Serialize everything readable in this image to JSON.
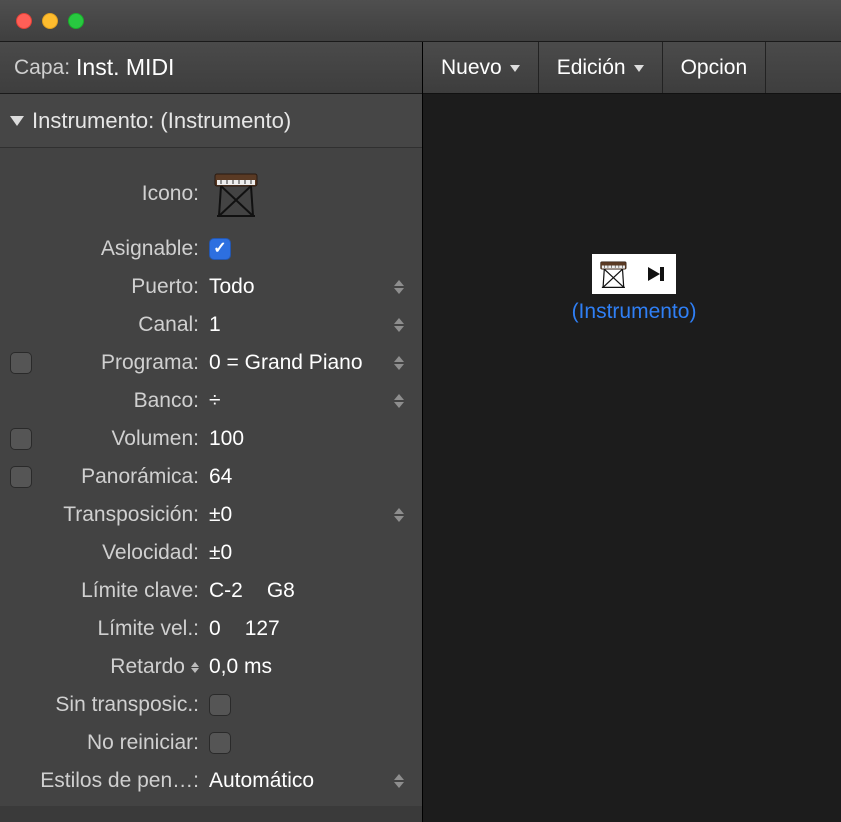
{
  "titlebar": {},
  "toolbar": {
    "buttons": [
      {
        "label": "Nuevo"
      },
      {
        "label": "Edición"
      },
      {
        "label": "Opcion"
      }
    ]
  },
  "layer": {
    "label": "Capa:",
    "value": "Inst. MIDI"
  },
  "section": {
    "title": "Instrumento: (Instrumento)"
  },
  "params": {
    "icono_label": "Icono:",
    "asignable_label": "Asignable:",
    "asignable_checked": true,
    "puerto_label": "Puerto:",
    "puerto_value": "Todo",
    "canal_label": "Canal:",
    "canal_value": "1",
    "programa_label": "Programa:",
    "programa_value": "0 = Grand Piano",
    "banco_label": "Banco:",
    "banco_value": "÷",
    "volumen_label": "Volumen:",
    "volumen_value": "100",
    "panoramica_label": "Panorámica:",
    "panoramica_value": "64",
    "transposicion_label": "Transposición:",
    "transposicion_value": "±0",
    "velocidad_label": "Velocidad:",
    "velocidad_value": "±0",
    "limite_clave_label": "Límite clave:",
    "limite_clave_lo": "C-2",
    "limite_clave_hi": "G8",
    "limite_vel_label": "Límite vel.:",
    "limite_vel_lo": "0",
    "limite_vel_hi": "127",
    "retardo_label": "Retardo",
    "retardo_value": "0,0 ms",
    "sin_transposic_label": "Sin transposic.:",
    "no_reiniciar_label": "No reiniciar:",
    "estilos_label": "Estilos de pen…:",
    "estilos_value": "Automático"
  },
  "canvas": {
    "object_label": "(Instrumento)"
  }
}
